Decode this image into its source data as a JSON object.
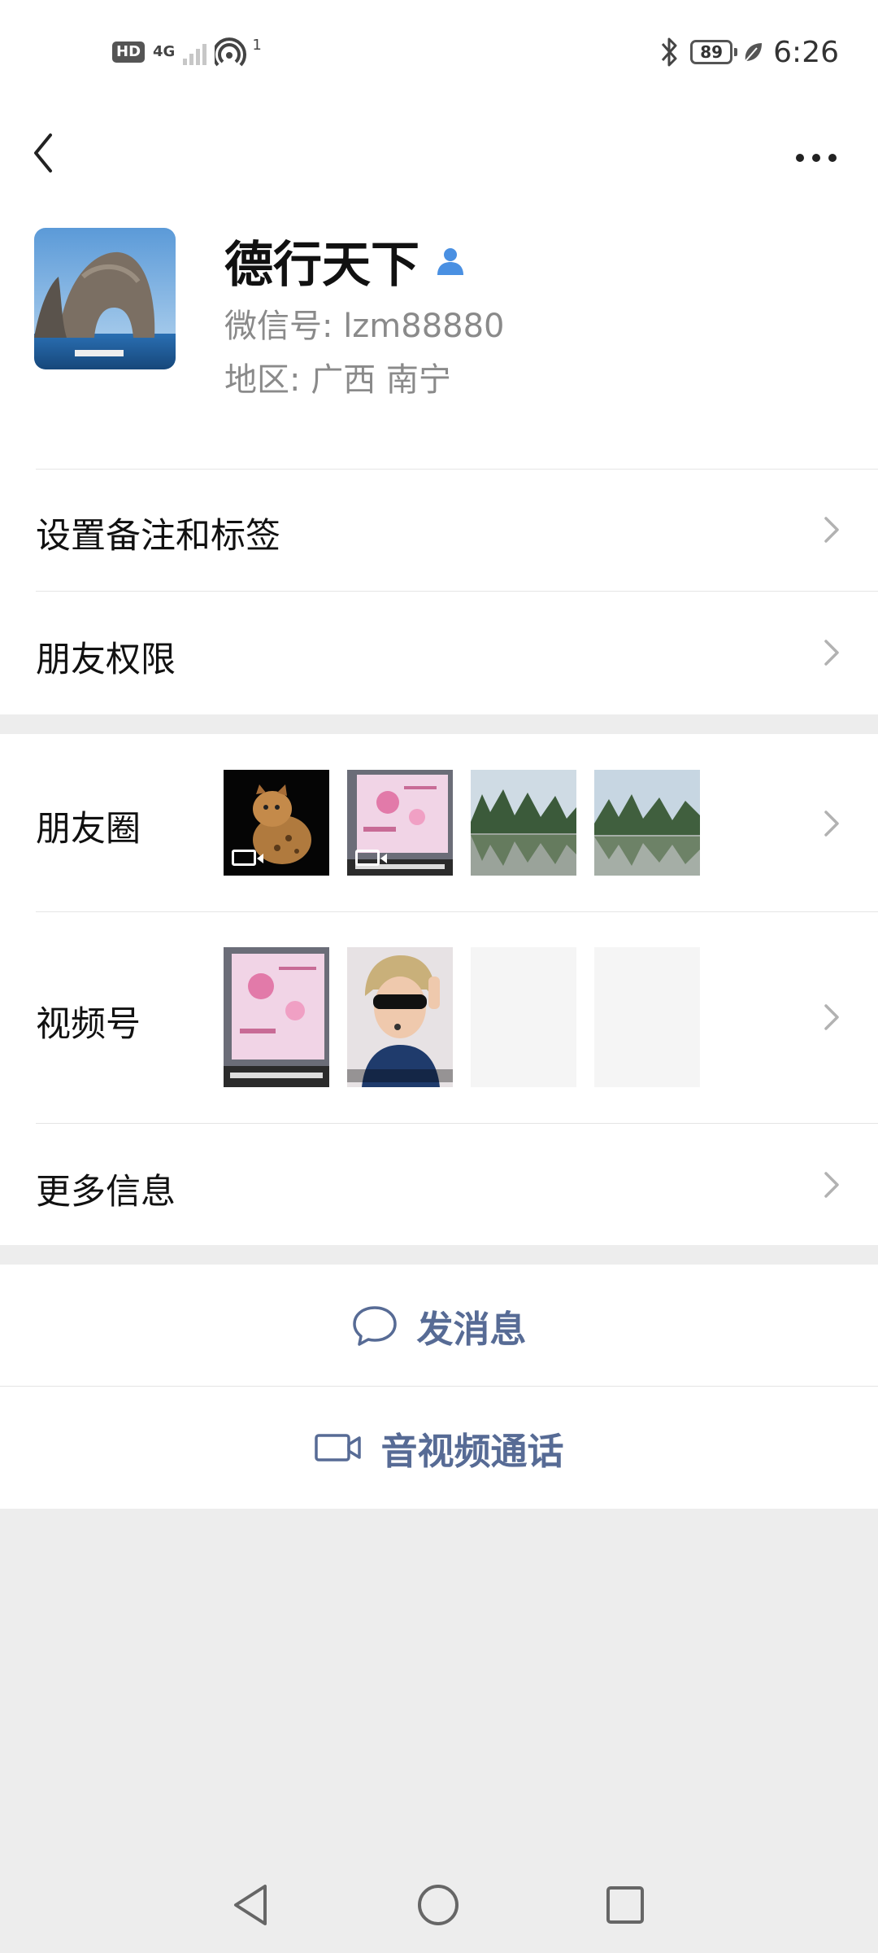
{
  "status_bar": {
    "hd": "HD",
    "network": "4G",
    "hotspot_count": "1",
    "battery": "89",
    "time": "6:26"
  },
  "profile": {
    "name": "德行天下",
    "wechat_id": "微信号: lzm88880",
    "region": "地区: 广西  南宁"
  },
  "menu": {
    "remark_tags": "设置备注和标签",
    "friend_permissions": "朋友权限",
    "moments": "朋友圈",
    "channels": "视频号",
    "more_info": "更多信息"
  },
  "actions": {
    "send_message": "发消息",
    "voice_video_call": "音视频通话"
  },
  "colors": {
    "link": "#576b95",
    "background": "#ededed",
    "icon_blue": "#4a90e2"
  },
  "icons": {
    "back": "chevron-left-icon",
    "more": "more-dots-icon",
    "contact": "person-icon",
    "chevron": "chevron-right-icon",
    "message": "chat-bubble-icon",
    "video": "video-camera-icon"
  }
}
